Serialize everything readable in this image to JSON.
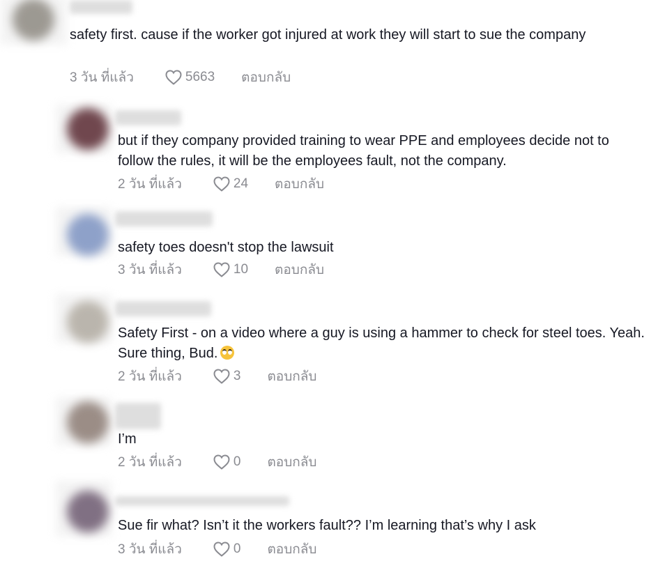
{
  "comments": [
    {
      "text": "safety first. cause if the worker got injured at work they will start to sue the company",
      "time": "3 วัน ที่แล้ว",
      "likes": "5663",
      "reply": "ตอบกลับ",
      "avatar_color": "#8e8a82"
    },
    {
      "text": "but if they company provided training to wear PPE and employees decide not to follow the rules, it will be the employees fault, not the company.",
      "time": "2 วัน ที่แล้ว",
      "likes": "24",
      "reply": "ตอบกลับ",
      "avatar_color": "#5a2a32"
    },
    {
      "text": "safety toes doesn't stop the lawsuit",
      "time": "3 วัน ที่แล้ว",
      "likes": "10",
      "reply": "ตอบกลับ",
      "avatar_color": "#7d93c2"
    },
    {
      "text": "Safety First - on a video where a guy is using a hammer to check for steel toes. Yeah. Sure thing, Bud.",
      "time": "2 วัน ที่แล้ว",
      "likes": "3",
      "reply": "ตอบกลับ",
      "avatar_color": "#b1aba1"
    },
    {
      "text": "I’m",
      "time": "2 วัน ที่แล้ว",
      "likes": "0",
      "reply": "ตอบกลับ",
      "avatar_color": "#8c7c74"
    },
    {
      "text": "Sue fir what? Isn’t it the workers fault?? I’m learning that’s why I ask",
      "time": "3 วัน ที่แล้ว",
      "likes": "0",
      "reply": "ตอบกลับ",
      "avatar_color": "#6d5a70"
    }
  ]
}
